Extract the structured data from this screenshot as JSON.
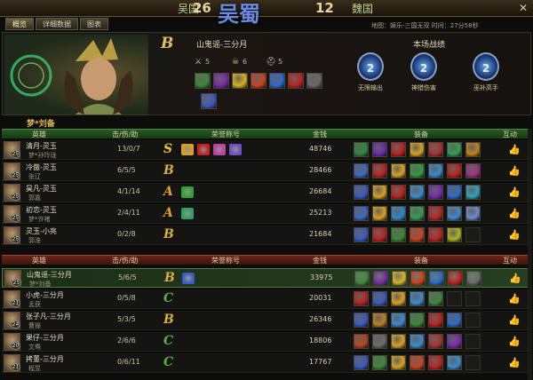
{
  "topbar": {
    "team_left": "吴国",
    "score_left": "26",
    "logo": "吴蜀",
    "score_right": "12",
    "team_right": "魏国",
    "close": "✕"
  },
  "tabs": [
    "概览",
    "详细数据",
    "图表"
  ],
  "map_info": "地图：娱乐-三国无双    时间：27分58秒",
  "featured": {
    "grade": "B",
    "name": "山鬼谣-三分月",
    "kills": "5",
    "deaths": "6",
    "assists": "5",
    "items_row1": [
      "#3a8a3a",
      "#7a2ab0",
      "#d8b020",
      "#d04020",
      "#2a6ad0",
      "#c02020",
      "#6a6a6a"
    ],
    "items_row2": [
      "#3a5ac8"
    ]
  },
  "match_stats": {
    "title": "本场战绩",
    "medals": [
      {
        "num": "2",
        "label": "无限输出"
      },
      {
        "num": "2",
        "label": "神猎伤害"
      },
      {
        "num": "2",
        "label": "巫补高手"
      }
    ]
  },
  "section_name": "梦*刘备",
  "headers": {
    "hero": "英雄",
    "kda": "击/伤/助",
    "honor": "荣誉称号",
    "gold": "金钱",
    "items": "装备",
    "interact": "互动"
  },
  "team_wu": [
    {
      "name": "清月-灵玉",
      "level": "25",
      "sub": "梦*孙玲珑",
      "kda": "13/0/7",
      "grade": "S",
      "grade_color": "#f0c030",
      "honors": [
        "#d8a020",
        "#c02020",
        "#c040a0",
        "#7050c0"
      ],
      "gold": "48746",
      "items": [
        "#2a8a3a",
        "#6a2ab0",
        "#c02020",
        "#d8a020",
        "#b03030",
        "#30a050",
        "#c08020"
      ]
    },
    {
      "name": "冷傲-灵玉",
      "level": "25",
      "sub": "张辽",
      "kda": "6/5/5",
      "grade": "B",
      "grade_color": "#d8b040",
      "honors": [],
      "gold": "28466",
      "items": [
        "#3a6ac8",
        "#c02020",
        "#d8a020",
        "#2aa040",
        "#3a8ad0",
        "#c02020",
        "#a03080"
      ]
    },
    {
      "name": "昊凡-灵玉",
      "level": "25",
      "sub": "郭嘉",
      "kda": "4/1/14",
      "grade": "A",
      "grade_color": "#e0a030",
      "honors": [
        "#30a030"
      ],
      "gold": "26684",
      "items": [
        "#3a5ac8",
        "#d8a020",
        "#c02020",
        "#3a8ad0",
        "#7a2ab0",
        "#2a6ad0",
        "#30a0c0"
      ]
    },
    {
      "name": "初恋-灵玉",
      "level": "25",
      "sub": "梦*许褚",
      "kda": "2/4/11",
      "grade": "A",
      "grade_color": "#e0a030",
      "honors": [
        "#30a060"
      ],
      "gold": "25213",
      "items": [
        "#3a6ac8",
        "#d8a020",
        "#2a8ad0",
        "#30a050",
        "#c02020",
        "#3a8ad0",
        "#6a8ad0"
      ]
    },
    {
      "name": "灵玉-小亮",
      "level": "25",
      "sub": "郭淮",
      "kda": "0/2/8",
      "grade": "B",
      "grade_color": "#d8b040",
      "honors": [],
      "gold": "21684",
      "items": [
        "#3a5ac8",
        "#c02020",
        "#3a8a3a",
        "#d04020",
        "#c02020",
        "#b0b020",
        "empty"
      ]
    }
  ],
  "team_wei": [
    {
      "name": "山鬼谣-三分月",
      "level": "25",
      "sub": "梦*刘备",
      "kda": "5/6/5",
      "grade": "B",
      "grade_color": "#d8b040",
      "honors": [
        "#3a5ac8"
      ],
      "gold": "33975",
      "items": [
        "#3a8a3a",
        "#7a2ab0",
        "#d8b020",
        "#d04020",
        "#2a6ad0",
        "#c02020",
        "#6a6a6a"
      ]
    },
    {
      "name": "小虎-三分月",
      "level": "21",
      "sub": "孟获",
      "kda": "0/5/8",
      "grade": "C",
      "grade_color": "#60b040",
      "honors": [],
      "gold": "20031",
      "items": [
        "#c02020",
        "#3a5ac8",
        "#d8a020",
        "#3a8ad0",
        "#3a8a3a",
        "empty",
        "empty"
      ]
    },
    {
      "name": "张子凡-三分月",
      "level": "24",
      "sub": "曹操",
      "kda": "5/3/5",
      "grade": "B",
      "grade_color": "#d8b040",
      "honors": [],
      "gold": "26346",
      "items": [
        "#3a5ac8",
        "#c08020",
        "#3a8ad0",
        "#3a8a3a",
        "#c02020",
        "#2a6ad0",
        "empty"
      ]
    },
    {
      "name": "果仔-三分月",
      "level": "20",
      "sub": "文鸯",
      "kda": "2/6/6",
      "grade": "C",
      "grade_color": "#60b040",
      "honors": [],
      "gold": "18806",
      "items": [
        "#c04020",
        "#6a6a6a",
        "#d8a020",
        "#3a8ad0",
        "#b03030",
        "#7a2ab0",
        "empty"
      ]
    },
    {
      "name": "拷董-三分月",
      "level": "21",
      "sub": "程昱",
      "kda": "0/6/11",
      "grade": "C",
      "grade_color": "#60b040",
      "honors": [],
      "gold": "17767",
      "items": [
        "#3a5ac8",
        "#3a8a3a",
        "#d8a020",
        "#d04020",
        "#c02020",
        "#3a8ad0",
        "empty"
      ]
    }
  ]
}
